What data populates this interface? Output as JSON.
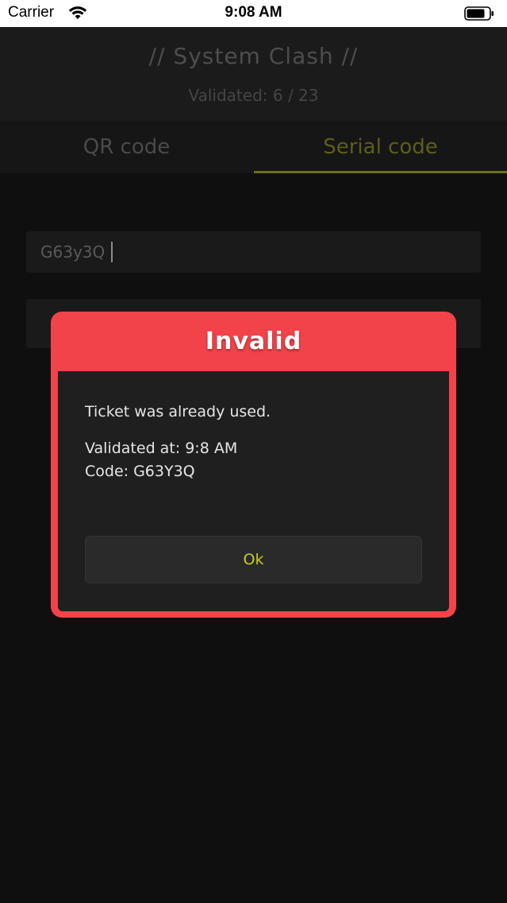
{
  "status_bar": {
    "carrier": "Carrier",
    "time": "9:08 AM"
  },
  "header": {
    "title": "// System Clash //",
    "validated": "Validated: 6 / 23"
  },
  "tabs": [
    {
      "label": "QR code",
      "active": false
    },
    {
      "label": "Serial code",
      "active": true
    }
  ],
  "serial_input": {
    "value": "G63y3Q"
  },
  "modal": {
    "title": "Invalid",
    "message": "Ticket was already used.",
    "validated_at": "Validated at: 9:8 AM",
    "code": "Code: G63Y3Q",
    "ok_label": "Ok"
  },
  "colors": {
    "background": "#0f0f10",
    "modal_red": "#f2434a",
    "accent_yellow": "#c6cc1d",
    "active_tab": "#5c5e1a"
  },
  "icons": {
    "wifi": "wifi-icon",
    "battery": "battery-icon"
  }
}
